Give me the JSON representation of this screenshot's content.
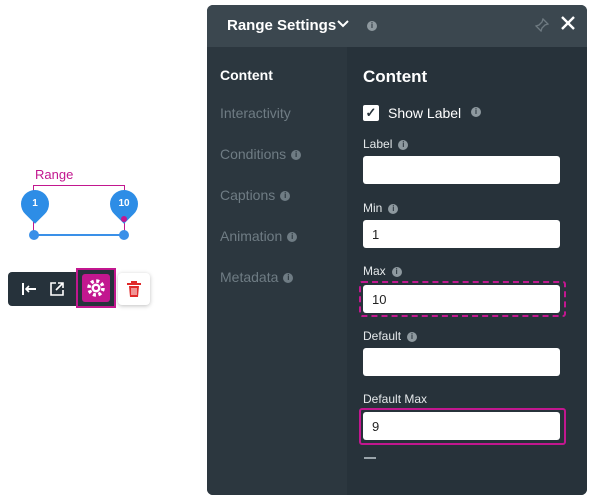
{
  "canvas": {
    "range_label": "Range",
    "handle_min_value": "1",
    "handle_max_value": "10"
  },
  "toolbar": {
    "icons": [
      "align-left-icon",
      "open-external-icon",
      "gear-icon",
      "trash-icon"
    ]
  },
  "panel": {
    "title": "Range Settings",
    "nav": [
      {
        "label": "Content",
        "active": true
      },
      {
        "label": "Interactivity"
      },
      {
        "label": "Conditions"
      },
      {
        "label": "Captions"
      },
      {
        "label": "Animation"
      },
      {
        "label": "Metadata"
      }
    ],
    "content": {
      "title": "Content",
      "show_label": {
        "label": "Show Label",
        "checked": true
      },
      "fields": [
        {
          "label": "Label",
          "value": ""
        },
        {
          "label": "Min",
          "value": "1"
        },
        {
          "label": "Max",
          "value": "10"
        },
        {
          "label": "Default",
          "value": ""
        },
        {
          "label": "Default Max",
          "value": "9"
        }
      ]
    }
  },
  "colors": {
    "accent": "#c2178f",
    "handle_blue": "#2d8de6",
    "panel_bg": "#313c44"
  }
}
